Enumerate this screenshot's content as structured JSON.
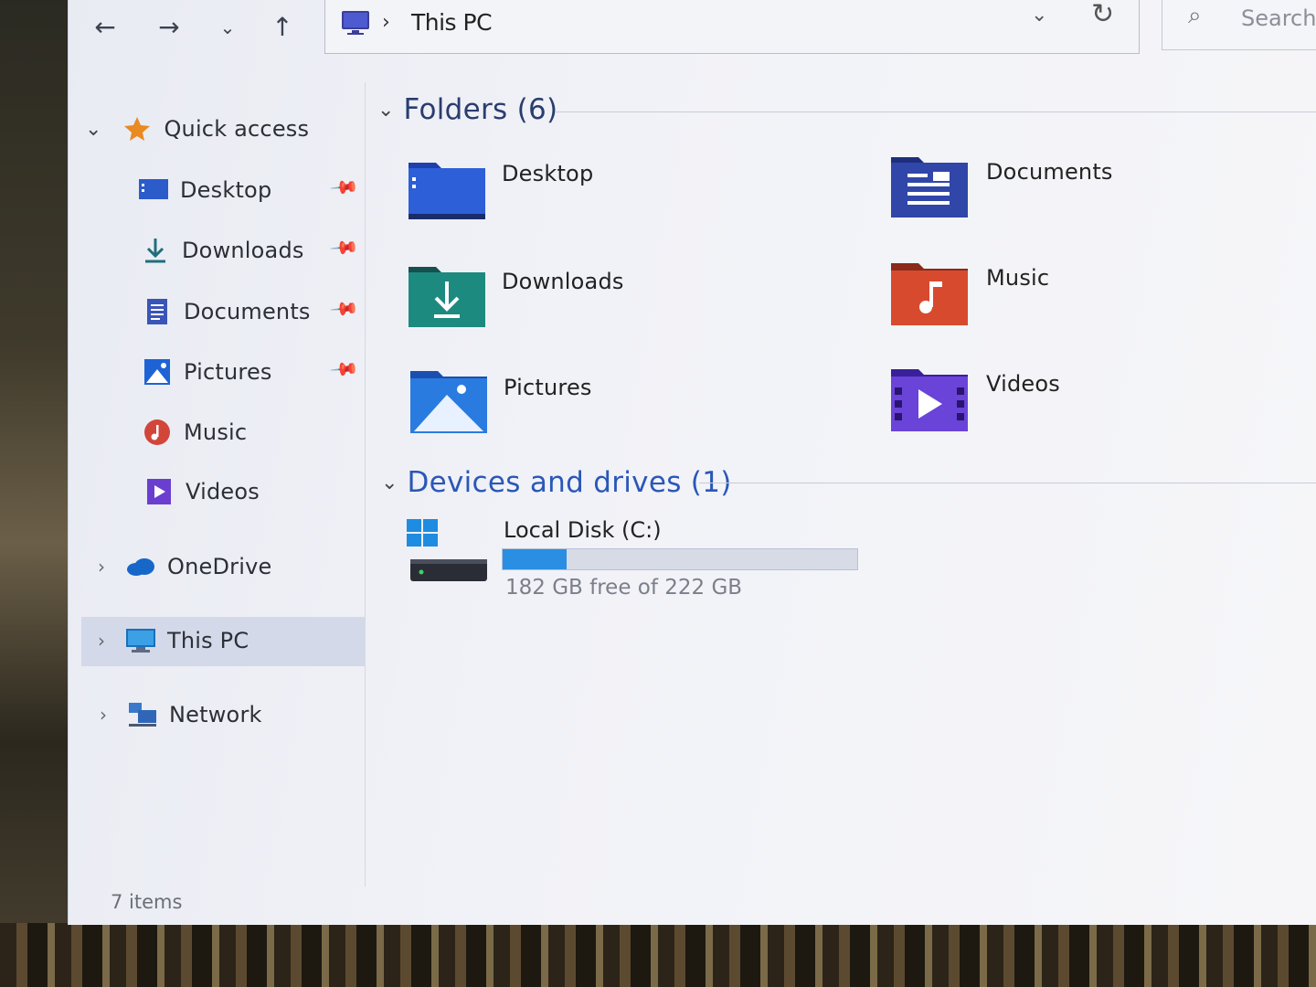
{
  "toolbar": {
    "back": "←",
    "forward": "→",
    "recent": "⌄",
    "up": "↑",
    "breadcrumb_sep": "›",
    "breadcrumb": "This PC",
    "dropdown": "⌄",
    "refresh": "↻",
    "search_icon": "⌕",
    "search_placeholder": "Search T"
  },
  "sidebar": {
    "quick_access": "Quick access",
    "items": [
      {
        "label": "Desktop",
        "icon": "desktop-icon",
        "pinned": true
      },
      {
        "label": "Downloads",
        "icon": "download-icon",
        "pinned": true
      },
      {
        "label": "Documents",
        "icon": "documents-icon",
        "pinned": true
      },
      {
        "label": "Pictures",
        "icon": "pictures-icon",
        "pinned": true
      },
      {
        "label": "Music",
        "icon": "music-icon",
        "pinned": false
      },
      {
        "label": "Videos",
        "icon": "videos-icon",
        "pinned": false
      }
    ],
    "onedrive": "OneDrive",
    "this_pc": "This PC",
    "network": "Network",
    "selected": "This PC"
  },
  "content": {
    "folders_header": "Folders (6)",
    "folders": [
      {
        "label": "Desktop",
        "icon": "desktop-folder-icon"
      },
      {
        "label": "Documents",
        "icon": "documents-folder-icon"
      },
      {
        "label": "Downloads",
        "icon": "downloads-folder-icon"
      },
      {
        "label": "Music",
        "icon": "music-folder-icon"
      },
      {
        "label": "Pictures",
        "icon": "pictures-folder-icon"
      },
      {
        "label": "Videos",
        "icon": "videos-folder-icon"
      }
    ],
    "drives_header": "Devices and drives (1)",
    "drive": {
      "name": "Local Disk (C:)",
      "free_text": "182 GB free of 222 GB",
      "used_fraction": 0.18
    }
  },
  "status": {
    "items": "7 items"
  },
  "colors": {
    "accent": "#2a8ee3",
    "selection": "#d4d9ea"
  }
}
